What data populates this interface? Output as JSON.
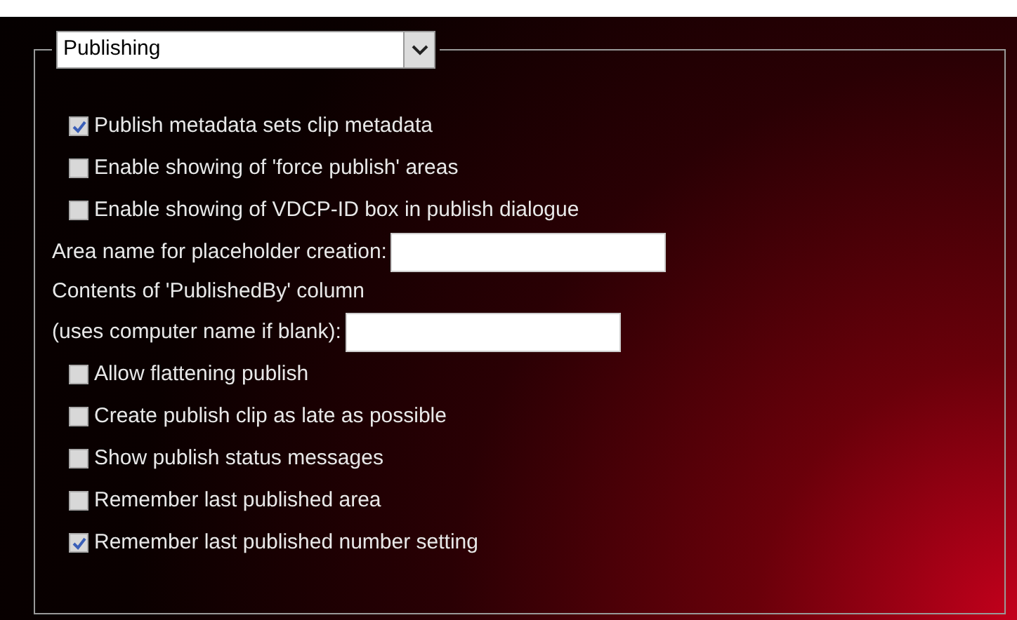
{
  "section_select": {
    "value": "Publishing"
  },
  "settings": [
    {
      "kind": "checkbox",
      "label": "Publish metadata sets clip metadata",
      "checked": true
    },
    {
      "kind": "checkbox",
      "label": "Enable showing of 'force publish' areas",
      "checked": false
    },
    {
      "kind": "checkbox",
      "label": "Enable showing of VDCP-ID box in publish dialogue",
      "checked": false
    },
    {
      "kind": "field",
      "label": "Area name for placeholder creation:"
    },
    {
      "kind": "label",
      "label": "Contents of 'PublishedBy' column"
    },
    {
      "kind": "field",
      "label": "(uses computer name if blank):"
    },
    {
      "kind": "checkbox",
      "label": "Allow flattening publish",
      "checked": false
    },
    {
      "kind": "checkbox",
      "label": "Create publish clip as late as possible",
      "checked": false
    },
    {
      "kind": "checkbox",
      "label": "Show publish status messages",
      "checked": false
    },
    {
      "kind": "checkbox",
      "label": "Remember last published area",
      "checked": false
    },
    {
      "kind": "checkbox",
      "label": "Remember last published number setting",
      "checked": true
    }
  ]
}
